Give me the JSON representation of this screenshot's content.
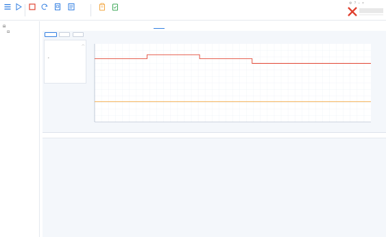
{
  "toolbar": {
    "items": [
      {
        "label": ""
      },
      {
        "label": ""
      },
      {
        "label": ""
      },
      {
        "label": ""
      },
      {
        "label": ""
      },
      {
        "label": ""
      },
      {
        "label": ""
      },
      {
        "label": ""
      }
    ]
  },
  "status_bar": {
    "row1": [
      {
        "label": "",
        "value": ""
      },
      {
        "label": "",
        "value": ""
      }
    ],
    "row2": [
      {
        "label": "",
        "value": ""
      },
      {
        "label": "",
        "value": ""
      }
    ]
  },
  "sidebar": {
    "root": "",
    "sub": "",
    "items": [
      {
        "label": ""
      },
      {
        "label": ""
      },
      {
        "label": ""
      },
      {
        "label": ""
      },
      {
        "label": ""
      },
      {
        "label": ""
      },
      {
        "label": ""
      },
      {
        "label": ""
      }
    ]
  },
  "tabs": [
    {
      "label": ""
    },
    {
      "label": ""
    },
    {
      "label": ""
    },
    {
      "label": ""
    },
    {
      "label": ""
    },
    {
      "label": ""
    },
    {
      "label": ""
    },
    {
      "label": ""
    },
    {
      "label": ""
    }
  ],
  "actions": [
    {
      "label": ""
    },
    {
      "label": ""
    },
    {
      "label": ""
    }
  ],
  "settings_panel": {
    "title": "",
    "field1_label": "",
    "field1_value": "",
    "field2_label": "",
    "field2_value": ""
  },
  "lower_panel": {
    "title": ""
  },
  "colors": {
    "accent": "#2f7de1",
    "series_red": "#e0412f",
    "series_orange": "#f2a33a"
  },
  "chart_data": {
    "type": "line",
    "title": "",
    "xlabel": "",
    "ylabel": "",
    "y2label": "",
    "xlim": [
      0,
      10
    ],
    "ylim": [
      0,
      10
    ],
    "grid": true,
    "x_ticks": [
      {
        "value": 0,
        "label": ""
      },
      {
        "value": 1,
        "label": ""
      },
      {
        "value": 2,
        "label": ""
      },
      {
        "value": 3,
        "label": ""
      },
      {
        "value": 4,
        "label": ""
      },
      {
        "value": 5,
        "label": ""
      },
      {
        "value": 6,
        "label": ""
      },
      {
        "value": 7,
        "label": ""
      },
      {
        "value": 8,
        "label": ""
      },
      {
        "value": 9,
        "label": ""
      },
      {
        "value": 10,
        "label": ""
      }
    ],
    "y_ticks": [
      {
        "value": 0,
        "label": ""
      },
      {
        "value": 2,
        "label": ""
      },
      {
        "value": 4,
        "label": ""
      },
      {
        "value": 6,
        "label": ""
      },
      {
        "value": 8,
        "label": ""
      },
      {
        "value": 10,
        "label": ""
      }
    ],
    "y2_ticks": [
      {
        "value": 0,
        "label": ""
      },
      {
        "value": 2,
        "label": ""
      },
      {
        "value": 4,
        "label": ""
      },
      {
        "value": 6,
        "label": ""
      },
      {
        "value": 8,
        "label": ""
      },
      {
        "value": 10,
        "label": ""
      }
    ],
    "series": [
      {
        "color": "#e0412f",
        "x": [
          0,
          1.9,
          1.9,
          3.8,
          3.8,
          5.7,
          5.7,
          10
        ],
        "y": [
          8.1,
          8.1,
          8.6,
          8.6,
          8.1,
          8.1,
          7.5,
          7.5
        ]
      },
      {
        "color": "#f2a33a",
        "x": [
          0,
          10
        ],
        "y": [
          2.6,
          2.6
        ]
      }
    ]
  }
}
